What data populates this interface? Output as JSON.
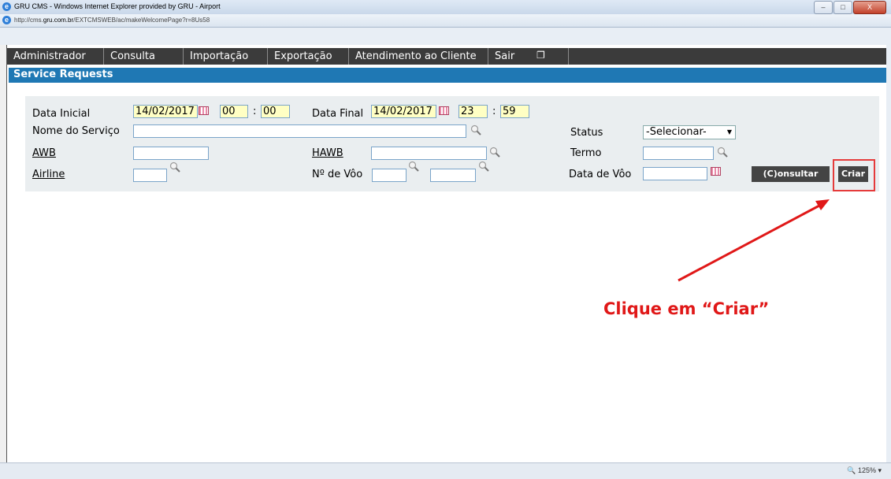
{
  "window": {
    "title": "GRU CMS - Windows Internet Explorer provided by GRU - Airport",
    "url_prefix": "http://cms.",
    "url_domain": "gru.com.br",
    "url_path": "/EXTCMSWEB/ac/makeWelcomePage?r=8Us58"
  },
  "menu": [
    "Administrador",
    "Consulta",
    "Importação",
    "Exportação",
    "Atendimento ao Cliente",
    "Sair"
  ],
  "section_title": "Service Requests",
  "form": {
    "data_inicial_label": "Data Inicial",
    "data_inicial_value": "14/02/2017",
    "hora_inicial": "00",
    "min_inicial": "00",
    "colon": ":",
    "data_final_label": "Data Final",
    "data_final_value": "14/02/2017",
    "hora_final": "23",
    "min_final": "59",
    "nome_servico_label": "Nome do Serviço",
    "status_label": "Status",
    "status_value": "-Selecionar-",
    "awb_label": "AWB",
    "hawb_label": "HAWB",
    "termo_label": "Termo",
    "airline_label": "Airline",
    "num_voo_label": "Nº de Vôo",
    "data_voo_label": "Data de Vôo",
    "consultar_label": "(C)onsultar",
    "criar_label": "Criar"
  },
  "annotation": "Clique em “Criar”",
  "status_zoom": "125%",
  "colors": {
    "menubar": "#3b3b3b",
    "section": "#1f78b4",
    "annotation": "#e01818",
    "highlight": "#e53b3b"
  }
}
